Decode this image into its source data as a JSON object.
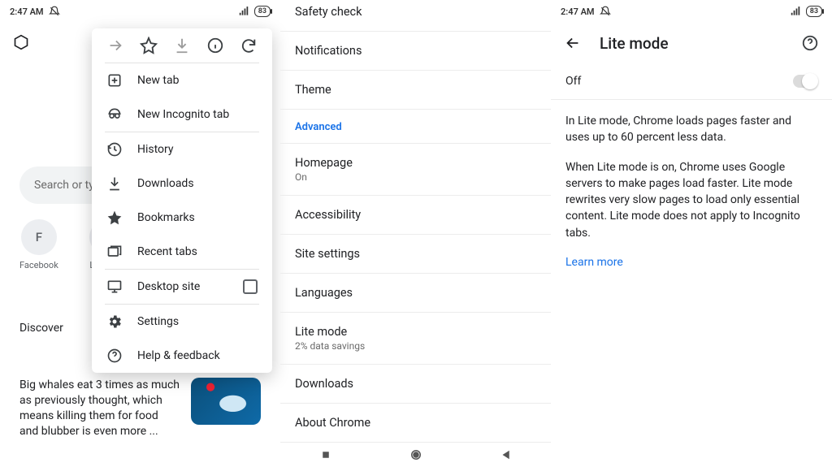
{
  "status": {
    "time": "2:47 AM",
    "battery": "83"
  },
  "pane1": {
    "search_placeholder": "Search or type",
    "shortcuts": [
      {
        "letter": "F",
        "label": "Facebook"
      },
      {
        "letter": "L",
        "label": "Limundo"
      }
    ],
    "discover_label": "Discover",
    "article_text": "Big whales eat 3 times as much as previously thought, which means killing them for food and blubber is even more ..."
  },
  "menu": {
    "items": {
      "new_tab": "New tab",
      "incognito": "New Incognito tab",
      "history": "History",
      "downloads": "Downloads",
      "bookmarks": "Bookmarks",
      "recent_tabs": "Recent tabs",
      "desktop_site": "Desktop site",
      "settings": "Settings",
      "help": "Help & feedback"
    }
  },
  "settings": {
    "safety_check": "Safety check",
    "notifications": "Notifications",
    "theme": "Theme",
    "advanced_label": "Advanced",
    "homepage": {
      "title": "Homepage",
      "sub": "On"
    },
    "accessibility": "Accessibility",
    "site_settings": "Site settings",
    "languages": "Languages",
    "lite_mode": {
      "title": "Lite mode",
      "sub": "2% data savings"
    },
    "downloads": "Downloads",
    "about": "About Chrome"
  },
  "lite": {
    "title": "Lite mode",
    "off_label": "Off",
    "p1": "In Lite mode, Chrome loads pages faster and uses up to 60 percent less data.",
    "p2": "When Lite mode is on, Chrome uses Google servers to make pages load faster. Lite mode rewrites very slow pages to load only essential content. Lite mode does not apply to Incognito tabs.",
    "learn_more": "Learn more"
  }
}
